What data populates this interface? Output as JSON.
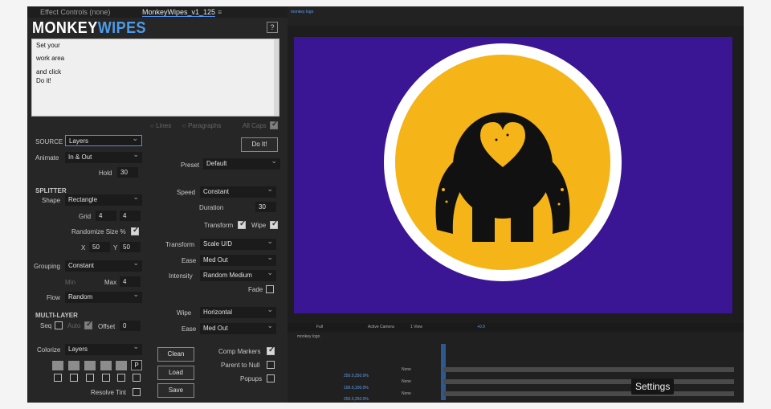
{
  "tabs": {
    "effect_controls": "Effect Controls (none)",
    "script": "MonkeyWipes_v1_125"
  },
  "logo": {
    "part1": "MONKEY",
    "part2": "WIPES"
  },
  "help_label": "?",
  "instructions": {
    "line1": "Set your",
    "line2": "work area",
    "line3": "and click",
    "line4": "Do it!"
  },
  "text_options": {
    "lines": "Lines",
    "paragraphs": "Paragraphs",
    "all_caps": "All Caps"
  },
  "source": {
    "label": "SOURCE",
    "value": "Layers"
  },
  "do_it": "Do It!",
  "animate": {
    "label": "Animate",
    "value": "In & Out"
  },
  "hold": {
    "label": "Hold",
    "value": "30"
  },
  "preset": {
    "label": "Preset",
    "value": "Default"
  },
  "splitter": {
    "title": "SPLITTER",
    "shape_label": "Shape",
    "shape_value": "Rectangle",
    "grid_label": "Grid",
    "grid_x": "4",
    "grid_y": "4",
    "randomize_label": "Randomize Size %",
    "x_label": "X",
    "x_value": "50",
    "y_label": "Y",
    "y_value": "50"
  },
  "speed": {
    "label": "Speed",
    "value": "Constant"
  },
  "duration": {
    "label": "Duration",
    "value": "30"
  },
  "transform_label": "Transform",
  "wipe_label": "Wipe",
  "transform": {
    "label": "Transform",
    "value": "Scale U/D"
  },
  "ease1": {
    "label": "Ease",
    "value": "Med Out"
  },
  "intensity": {
    "label": "Intensity",
    "value": "Random Medium"
  },
  "fade_label": "Fade",
  "grouping": {
    "label": "Grouping",
    "value": "Constant",
    "min": "Min",
    "max_label": "Max",
    "max_value": "4"
  },
  "flow": {
    "label": "Flow",
    "value": "Random"
  },
  "multilayer": {
    "title": "MULTI-LAYER",
    "seq": "Seq",
    "auto": "Auto",
    "offset_label": "Offset",
    "offset_value": "0"
  },
  "wipe": {
    "label": "Wipe",
    "value": "Horizontal"
  },
  "ease2": {
    "label": "Ease",
    "value": "Med Out"
  },
  "colorize": {
    "label": "Colorize",
    "value": "Layers",
    "p": "P"
  },
  "buttons": {
    "clean": "Clean",
    "load": "Load",
    "save": "Save"
  },
  "options": {
    "comp_markers": "Comp Markers",
    "parent_to_null": "Parent to Null",
    "popups": "Popups",
    "resolve_tint": "Resolve Tint"
  },
  "comp_tab": "monkey logo",
  "viewer": {
    "zoom": "Full",
    "camera": "Active Camera",
    "view": "1 View",
    "offset": "+0.0"
  },
  "timeline_tab": "monkey logo",
  "layer_rows": [
    {
      "value": "250.0,250.0%",
      "parent": "None"
    },
    {
      "value": "100.0,100.0%",
      "parent": "None"
    },
    {
      "value": "250.0,250.0%",
      "parent": "None"
    }
  ],
  "settings_caption": "Settings",
  "colors": {
    "accent": "#4d9be8",
    "comp_bg": "#3a1594",
    "badge": "#f5b417"
  }
}
